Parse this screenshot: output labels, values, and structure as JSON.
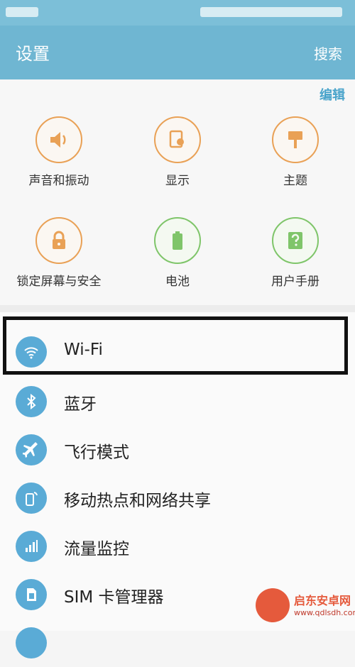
{
  "header": {
    "title": "设置",
    "search_label": "搜索"
  },
  "quick_settings": {
    "edit_label": "编辑",
    "tiles": [
      {
        "label": "声音和振动",
        "icon": "speaker-icon"
      },
      {
        "label": "显示",
        "icon": "display-icon"
      },
      {
        "label": "主题",
        "icon": "paintbrush-icon"
      },
      {
        "label": "锁定屏幕与安全",
        "icon": "lock-icon"
      },
      {
        "label": "电池",
        "icon": "battery-icon"
      },
      {
        "label": "用户手册",
        "icon": "help-book-icon"
      }
    ]
  },
  "settings_list": {
    "items": [
      {
        "label": "Wi-Fi",
        "icon": "wifi-icon"
      },
      {
        "label": "蓝牙",
        "icon": "bluetooth-icon"
      },
      {
        "label": "飞行模式",
        "icon": "airplane-icon"
      },
      {
        "label": "移动热点和网络共享",
        "icon": "hotspot-icon"
      },
      {
        "label": "流量监控",
        "icon": "data-usage-icon"
      },
      {
        "label": "SIM 卡管理器",
        "icon": "sim-card-icon"
      }
    ]
  },
  "watermark": {
    "brand": "启东安卓网",
    "url": "www.qdlsdh.com"
  },
  "colors": {
    "appbar": "#6fb6d2",
    "accent": "#4aa4cb",
    "orange": "#e9a156",
    "green": "#7fc56a"
  }
}
